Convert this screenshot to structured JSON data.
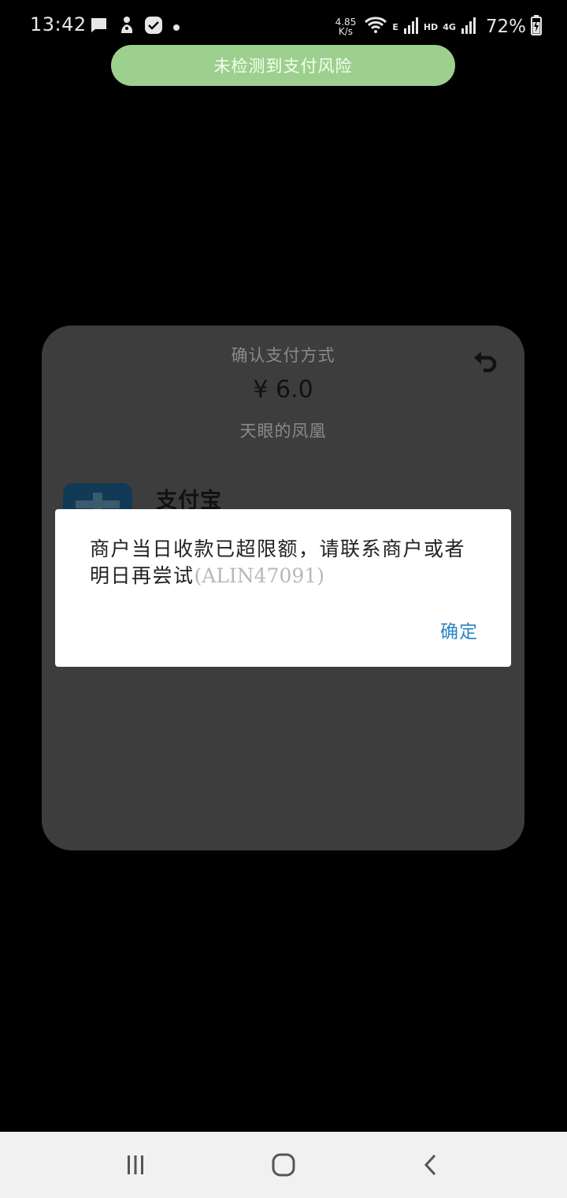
{
  "status_bar": {
    "time": "13:42",
    "net_speed_value": "4.85",
    "net_speed_unit": "K/s",
    "net_e": "E",
    "net_hd": "HD",
    "net_4g": "4G",
    "battery_percent": "72%",
    "icons": [
      "message-icon",
      "kangaroo-icon",
      "clock-app-icon",
      "dot-icon",
      "wifi-icon",
      "signal-icon",
      "signal-icon",
      "battery-charging-icon"
    ]
  },
  "risk_toast": {
    "text": "未检测到支付风险",
    "color": "#9dd08e"
  },
  "pay_sheet": {
    "title": "确认支付方式",
    "amount": "¥ 6.0",
    "merchant": "天眼的凤凰",
    "method_label": "支付宝",
    "back_icon": "undo-icon"
  },
  "dialog": {
    "message": "商户当日收款已超限额，请联系商户或者明日再尝试",
    "code": "(ALIN47091)",
    "ok_label": "确定",
    "ok_color": "#2a86c4"
  },
  "nav_bar": {
    "recents_icon": "recents-icon",
    "home_icon": "home-icon",
    "back_icon": "back-icon"
  }
}
